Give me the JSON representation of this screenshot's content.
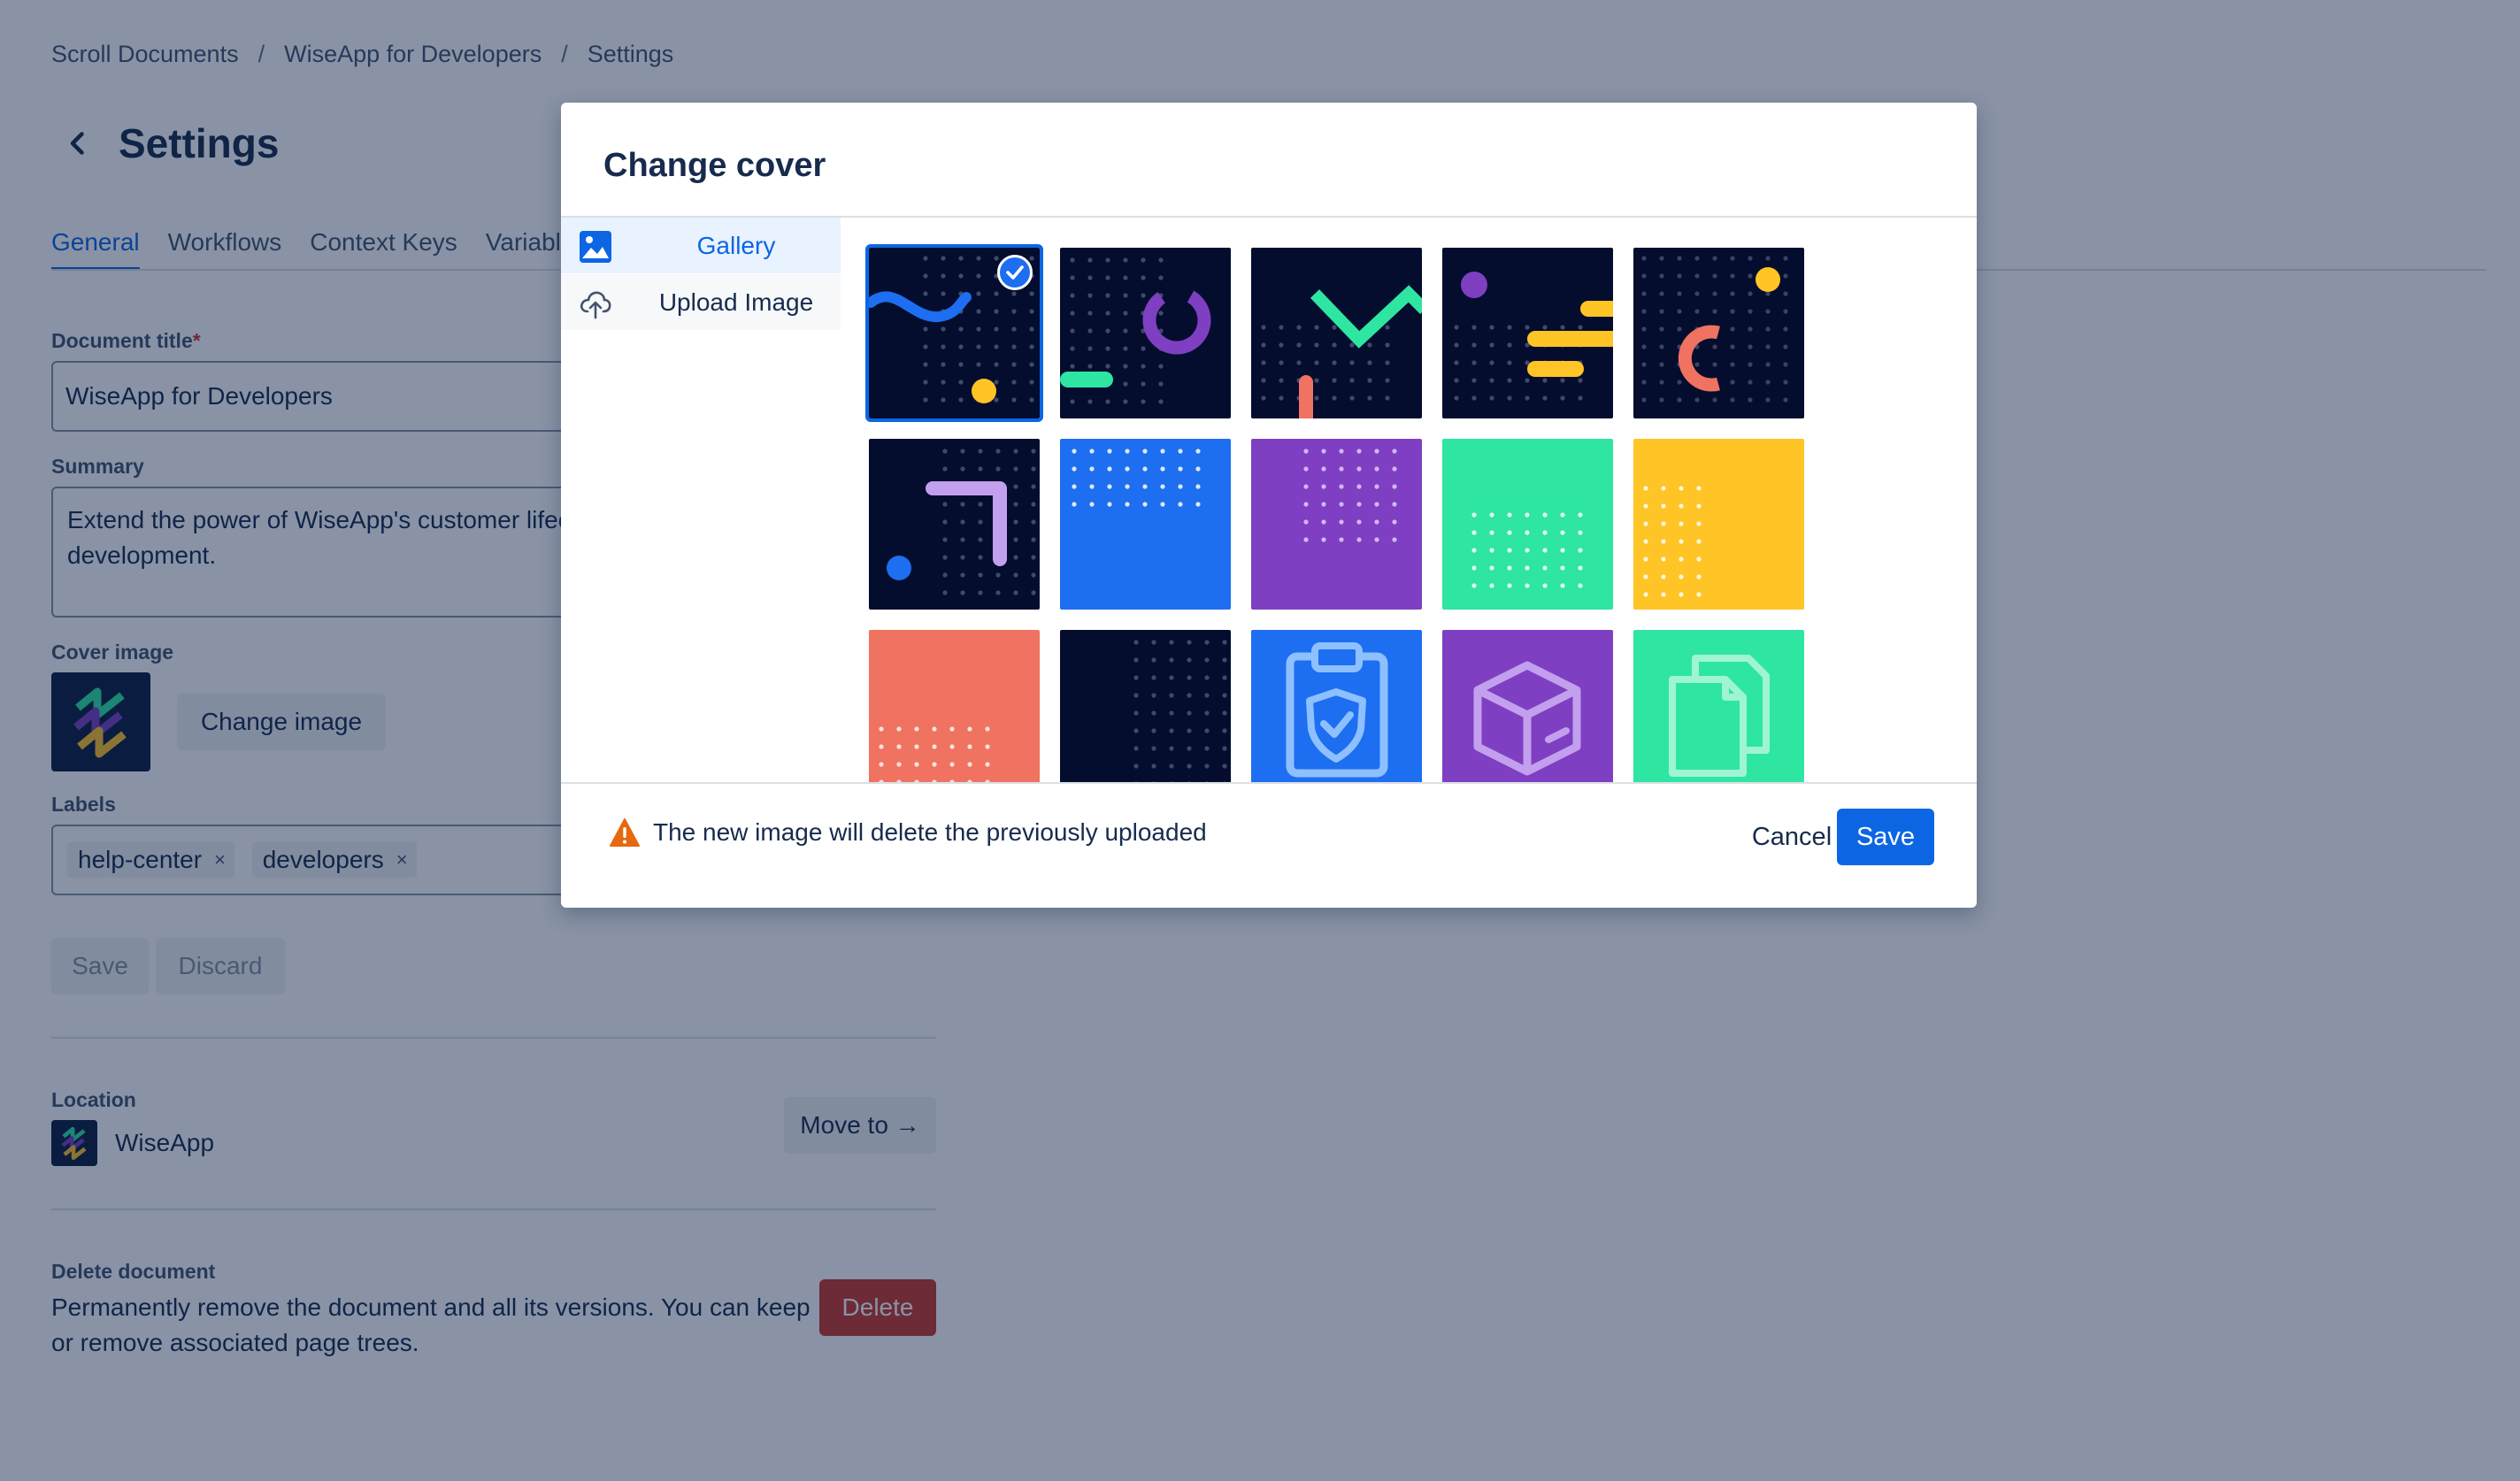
{
  "breadcrumb": [
    "Scroll Documents",
    "WiseApp for Developers",
    "Settings"
  ],
  "breadcrumb_separator": "/",
  "page_title": "Settings",
  "tabs": [
    {
      "label": "General",
      "active": true
    },
    {
      "label": "Workflows",
      "active": false
    },
    {
      "label": "Context Keys",
      "active": false
    },
    {
      "label": "Variables",
      "active": false
    }
  ],
  "form": {
    "title_label": "Document title",
    "title_required": "*",
    "title_value": "WiseApp for Developers",
    "summary_label": "Summary",
    "summary_value": "Extend the power of WiseApp's customer lifecycle platform with custom development.",
    "cover_label": "Cover image",
    "change_image_label": "Change image",
    "labels_label": "Labels",
    "labels": [
      "help-center",
      "developers"
    ],
    "chip_remove": "×",
    "save_label": "Save",
    "discard_label": "Discard"
  },
  "location": {
    "label": "Location",
    "space_name": "WiseApp",
    "move_label": "Move to →"
  },
  "delete": {
    "label": "Delete document",
    "description": "Permanently remove the document and all its versions. You can keep or remove associated page trees.",
    "button_label": "Delete"
  },
  "modal": {
    "title": "Change cover",
    "side_items": [
      {
        "label": "Gallery",
        "icon": "image-icon",
        "active": true
      },
      {
        "label": "Upload Image",
        "icon": "cloud-upload-icon",
        "active": false
      }
    ],
    "selected_index": 0,
    "warning_text": "The new image will delete the previously uploaded",
    "cancel_label": "Cancel",
    "save_label": "Save"
  },
  "colors": {
    "navy": "#050d2e",
    "blue": "#1d6ef0",
    "purple": "#7e3fc2",
    "green": "#2ee5a2",
    "yellow": "#ffc425",
    "coral": "#f07260",
    "lilac": "#c2a0ee",
    "accent": "#0c66e4",
    "danger": "#c9372c"
  }
}
